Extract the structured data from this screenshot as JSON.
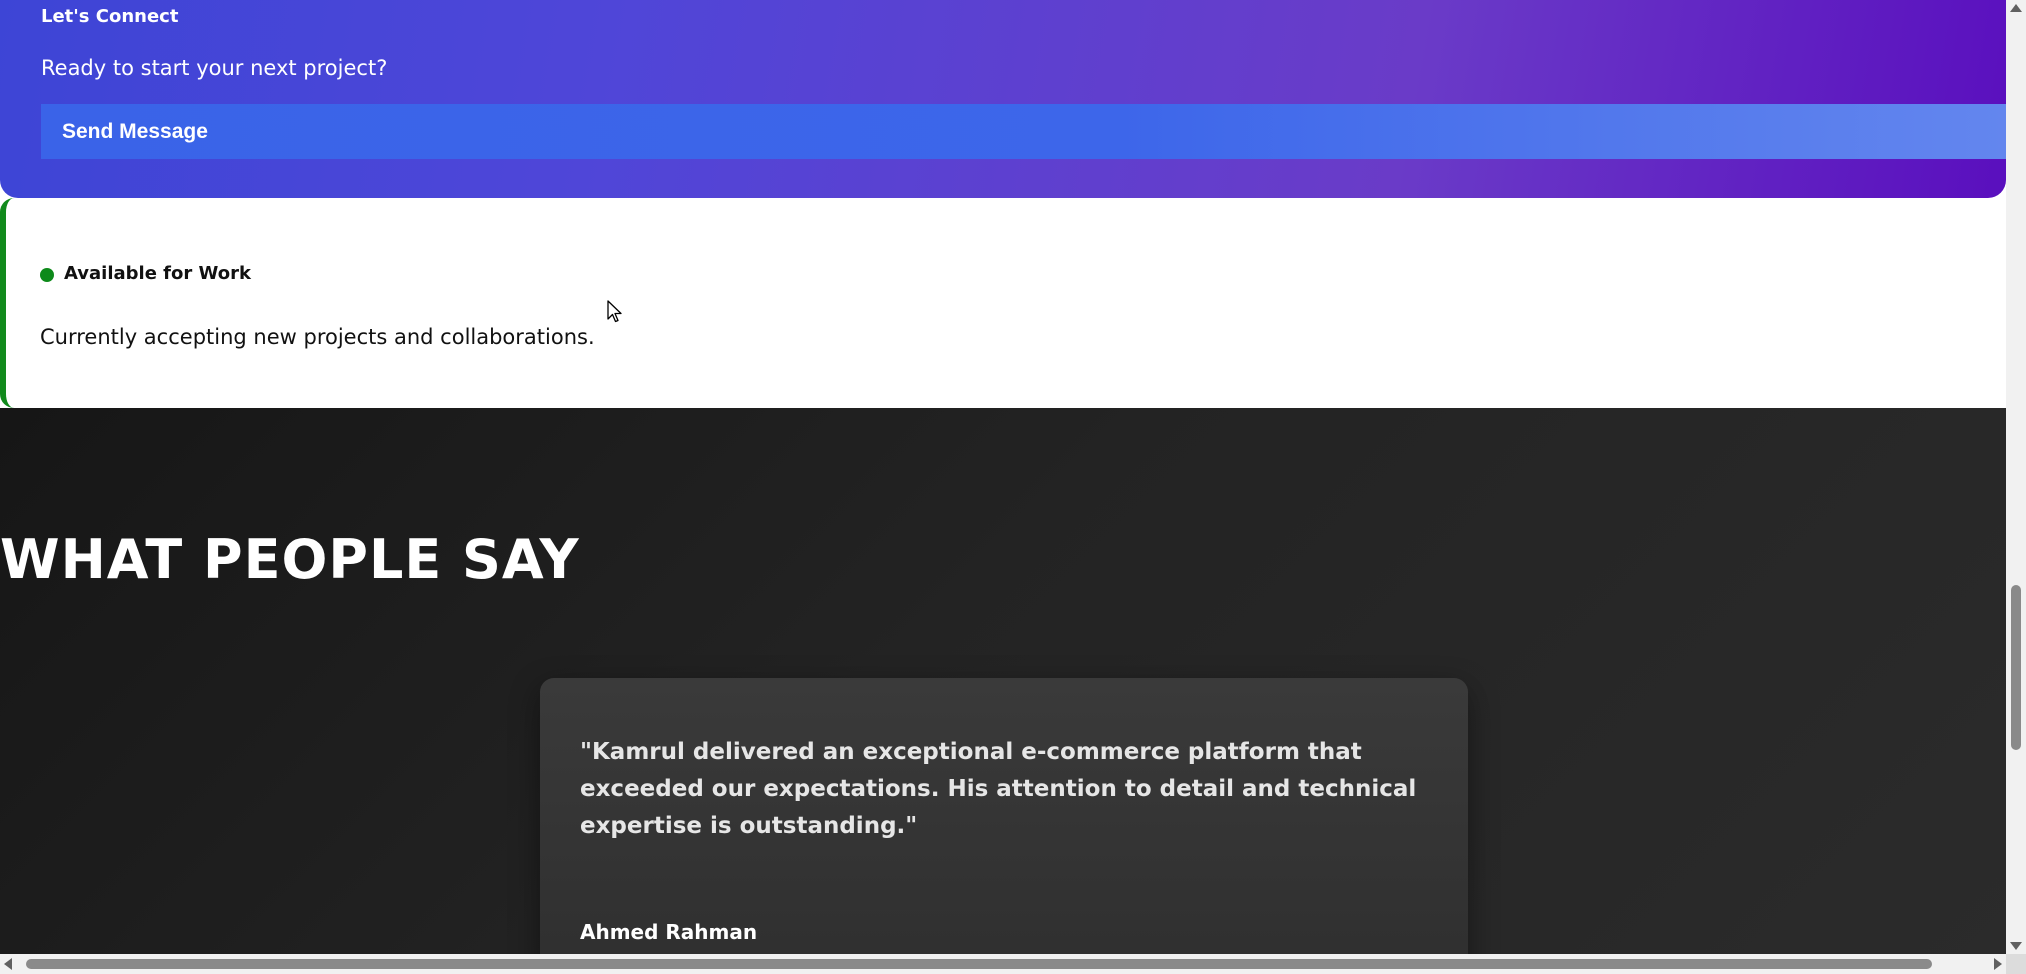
{
  "connect": {
    "title": "Let's Connect",
    "subtitle": "Ready to start your next project?",
    "button_label": "Send Message"
  },
  "availability": {
    "status": "Available for Work",
    "description": "Currently accepting new projects and collaborations.",
    "status_color": "#0d8a1a"
  },
  "testimonials": {
    "heading": "WHAT PEOPLE SAY",
    "items": [
      {
        "quote": "\"Kamrul delivered an exceptional e-commerce platform that exceeded our expectations. His attention to detail and technical expertise is outstanding.\"",
        "author": "Ahmed Rahman"
      }
    ]
  },
  "colors": {
    "accent_blue": "#3a63e8",
    "gradient_purple": "#5a0fbe",
    "dark_bg": "#1f1f1f"
  },
  "icons": {
    "cursor": "mouse-pointer-icon",
    "status": "status-dot-icon"
  }
}
